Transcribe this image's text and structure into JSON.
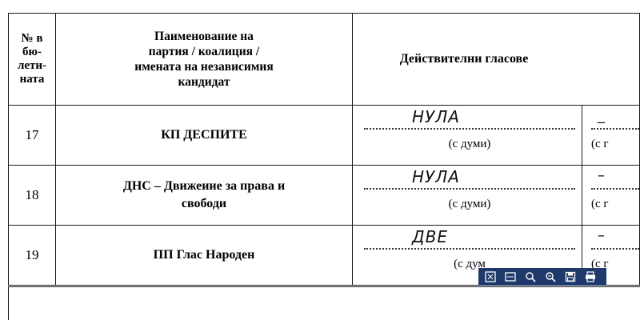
{
  "table": {
    "headers": {
      "number": [
        "№ в",
        "бю-",
        "лети-",
        "ната"
      ],
      "name": [
        "Пaименование на",
        "партия / коалиция /",
        "имената на независимия",
        "кандидат"
      ],
      "votes": "Действителни гласове"
    },
    "rows": [
      {
        "number": "17",
        "party": "КП ДЕСПИТЕ",
        "votes_words": "НУЛА",
        "caption": "(с думи)",
        "caption_2": "(с г",
        "second_words": "_"
      },
      {
        "number": "18",
        "party_line1": "ДНС – Движеиие за права и",
        "party_line2": "свободи",
        "votes_words": "НУЛА",
        "caption": "(с думи)",
        "caption_2": "(с г",
        "second_words": "–"
      },
      {
        "number": "19",
        "party": "ПП Глас Народен",
        "votes_words": "ДВЕ",
        "caption": "(с дум",
        "caption_2": "(с г",
        "second_words": "–"
      }
    ]
  },
  "toolbar": {
    "buttons": [
      {
        "name": "fit-page-icon"
      },
      {
        "name": "fit-width-icon"
      },
      {
        "name": "zoom-in-icon"
      },
      {
        "name": "zoom-out-icon"
      },
      {
        "name": "save-icon"
      },
      {
        "name": "print-icon"
      }
    ],
    "background": "#1f3a6a"
  }
}
